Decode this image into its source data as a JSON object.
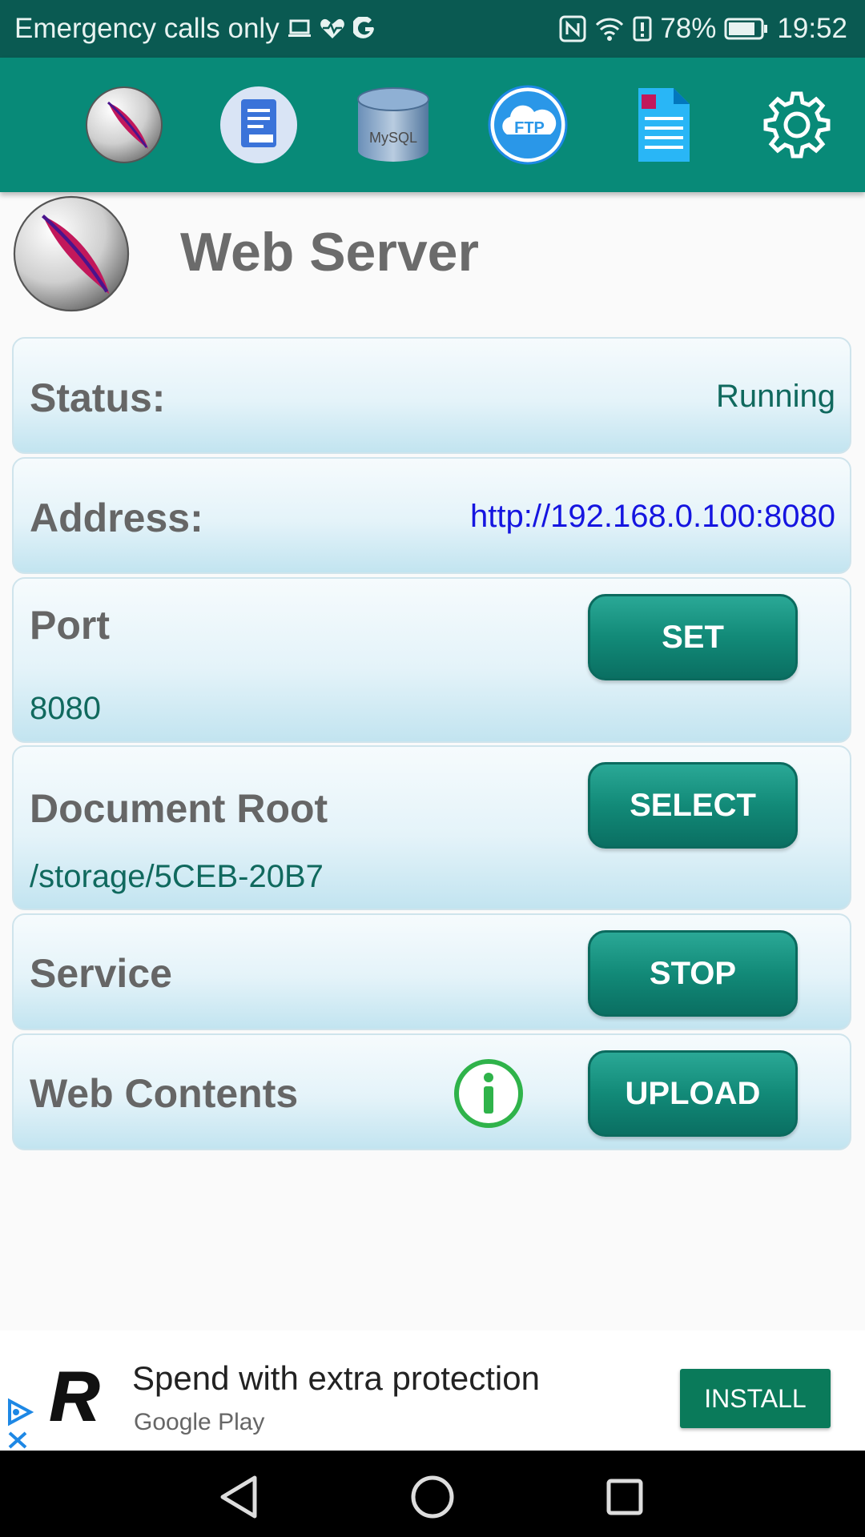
{
  "status_bar": {
    "carrier": "Emergency calls only",
    "battery": "78%",
    "time": "19:52",
    "icons": [
      "laptop-icon",
      "heart-pulse-icon",
      "google-icon",
      "nfc-icon",
      "wifi-icon",
      "alert-icon",
      "battery-icon"
    ]
  },
  "toolbar": {
    "items": [
      {
        "name": "web-server-tab",
        "icon": "feather-icon"
      },
      {
        "name": "php-tab",
        "icon": "document-icon"
      },
      {
        "name": "mysql-tab",
        "icon": "database-icon",
        "text": "MySQL"
      },
      {
        "name": "ftp-tab",
        "icon": "cloud-ftp-icon",
        "text": "FTP"
      },
      {
        "name": "log-tab",
        "icon": "log-file-icon"
      },
      {
        "name": "settings-tab",
        "icon": "gear-icon"
      }
    ]
  },
  "page": {
    "title": "Web Server"
  },
  "status": {
    "label": "Status:",
    "value": "Running"
  },
  "address": {
    "label": "Address:",
    "value": "http://192.168.0.100:8080",
    "link_color": "#1515e0"
  },
  "port": {
    "label": "Port",
    "value": "8080",
    "button": "SET"
  },
  "document_root": {
    "label": "Document Root",
    "value": "/storage/5CEB-20B7",
    "button": "SELECT"
  },
  "service": {
    "label": "Service",
    "button": "STOP"
  },
  "web_contents": {
    "label": "Web Contents",
    "button": "UPLOAD",
    "info_icon": "info-icon"
  },
  "ad": {
    "title": "Spend with extra protection",
    "subtitle": "Google Play",
    "install": "INSTALL",
    "logo_letter": "R"
  },
  "colors": {
    "status_bar": "#0a5a52",
    "toolbar": "#088a78",
    "button": "#128a78",
    "value_text": "#10695e"
  }
}
